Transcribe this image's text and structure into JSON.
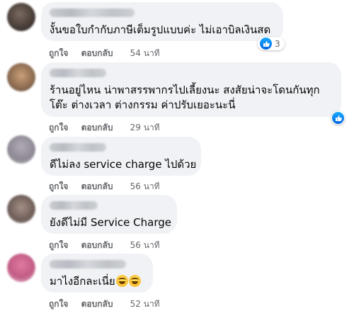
{
  "actions": {
    "like_label": "ถูกใจ",
    "reply_label": "ตอบกลับ"
  },
  "comments": [
    {
      "text_lines": [
        "งั้นขอใบกำกับภาษีเต็มรูปแบบค่ะ ไม่เอาบิลเงินสด"
      ],
      "time": "54 นาที",
      "reaction": {
        "icon": "like-icon",
        "count": "3"
      }
    },
    {
      "text_lines": [
        "ร้านอยู่ไหน น่าพาสรรพากรไปเลี้ยงนะ สงสัยน่าจะโดนกันทุก",
        "โต๊ะ ต่างเวลา ต่างกรรม ค่าปรับเยอะนะนี่"
      ],
      "time": "29 นาที",
      "reaction": {
        "icon": "like-icon",
        "count": ""
      }
    },
    {
      "text_lines": [
        "ดีไม่ลง service charge ไปด้วย"
      ],
      "time": "56 นาที"
    },
    {
      "text_lines": [
        "ยังดีไม่มี Service Charge"
      ],
      "time": "56 นาที"
    },
    {
      "text_lines": [
        "มาไงอีกละเนี่ย"
      ],
      "emoji": [
        "grinning-face-icon",
        "grinning-face-icon"
      ],
      "time": "52 นาที"
    }
  ],
  "colors": {
    "bubble": "#f0f2f5",
    "like_blue": "#1877f2",
    "meta_text": "#65676b"
  }
}
